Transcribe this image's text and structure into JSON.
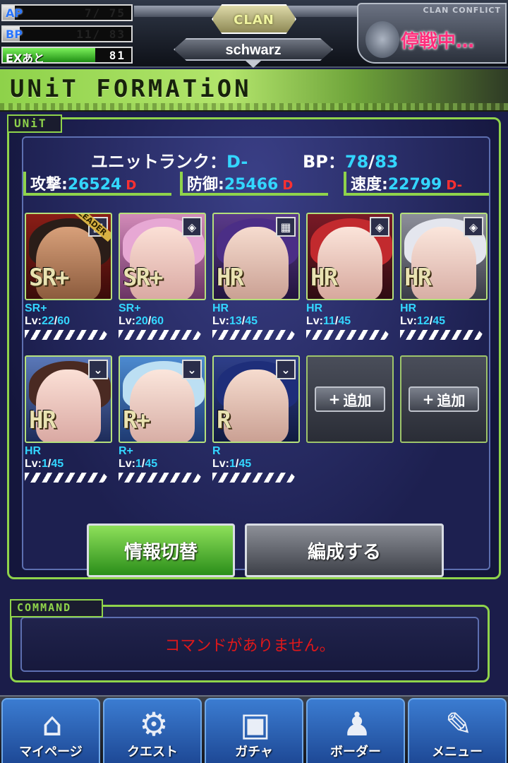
{
  "header": {
    "ap": {
      "label": "AP",
      "value": "7/ 75",
      "fraction": 0.093
    },
    "bp": {
      "label": "BP",
      "value": "11/ 83",
      "fraction": 0.133
    },
    "ex": {
      "label": "EXあと",
      "value": "81",
      "fraction": 0.72
    },
    "clan": {
      "label": "CLAN",
      "name": "schwarz"
    },
    "conflict": {
      "title": "CLAN CONFLICT",
      "status": "停戦中…"
    }
  },
  "banner": {
    "title": "UNiT FORMATiON"
  },
  "unit": {
    "tag": "UNiT",
    "rank_label": "ユニットランク：",
    "rank_value": "D-",
    "bp_label": "BP：",
    "bp_current": "78",
    "bp_sep": "/",
    "bp_max": "83",
    "attack": {
      "label": "攻撃:",
      "value": "26524",
      "grade": "D"
    },
    "defense": {
      "label": "防御:",
      "value": "25466",
      "grade": "D"
    },
    "speed": {
      "label": "速度:",
      "value": "22799",
      "grade": "D-"
    },
    "cards": [
      {
        "rarity": "SR+",
        "lv_prefix": "Lv:",
        "lv": "22",
        "lv_max": "60",
        "art": "SR+",
        "leader": "LEADER",
        "corner": "▦"
      },
      {
        "rarity": "SR+",
        "lv_prefix": "Lv:",
        "lv": "20",
        "lv_max": "60",
        "art": "SR+",
        "corner": "◈"
      },
      {
        "rarity": "HR",
        "lv_prefix": "Lv:",
        "lv": "13",
        "lv_max": "45",
        "art": "HR",
        "corner": "▦"
      },
      {
        "rarity": "HR",
        "lv_prefix": "Lv:",
        "lv": "11",
        "lv_max": "45",
        "art": "HR",
        "corner": "◈"
      },
      {
        "rarity": "HR",
        "lv_prefix": "Lv:",
        "lv": "12",
        "lv_max": "45",
        "art": "HR",
        "corner": "◈"
      },
      {
        "rarity": "HR",
        "lv_prefix": "Lv:",
        "lv": "1",
        "lv_max": "45",
        "art": "HR",
        "corner": "⌄"
      },
      {
        "rarity": "R+",
        "lv_prefix": "Lv:",
        "lv": "1",
        "lv_max": "45",
        "art": "R+",
        "corner": "⌄"
      },
      {
        "rarity": "R",
        "lv_prefix": "Lv:",
        "lv": "1",
        "lv_max": "45",
        "art": "R",
        "corner": "⌄"
      }
    ],
    "add_label": "追加",
    "add_plus": "+",
    "btn_info": "情報切替",
    "btn_form": "編成する"
  },
  "command": {
    "tag": "COMMAND",
    "message": "コマンドがありません。"
  },
  "nav": [
    {
      "label": "マイページ",
      "icon": "home-icon"
    },
    {
      "label": "クエスト",
      "icon": "quest-icon"
    },
    {
      "label": "ガチャ",
      "icon": "gacha-icon"
    },
    {
      "label": "ボーダー",
      "icon": "border-icon"
    },
    {
      "label": "メニュー",
      "icon": "menu-icon"
    }
  ],
  "colors": {
    "accent_green": "#8fd34b",
    "cyan": "#33d6ff",
    "red": "#ff3030",
    "panel": "#1d2050"
  }
}
